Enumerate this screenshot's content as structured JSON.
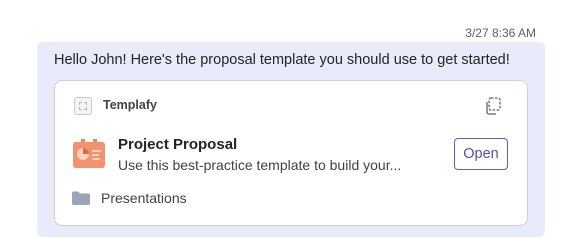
{
  "message": {
    "timestamp": "3/27 8:36 AM",
    "text": "Hello John! Here's the proposal template you should use to get started!"
  },
  "card": {
    "app_name": "Templafy",
    "item_title": "Project Proposal",
    "item_description": "Use this best-practice template to build your...",
    "open_label": "Open",
    "folder_label": "Presentations"
  },
  "icons": {
    "app": "templafy-app-icon",
    "copy": "copy-icon",
    "thumbnail": "presentation-thumbnail",
    "folder": "folder-icon"
  },
  "colors": {
    "bubble_background": "#e8ebfa",
    "accent": "#5b5fc7",
    "thumbnail_orange": "#f0845e",
    "folder": "#9aa5b8"
  }
}
